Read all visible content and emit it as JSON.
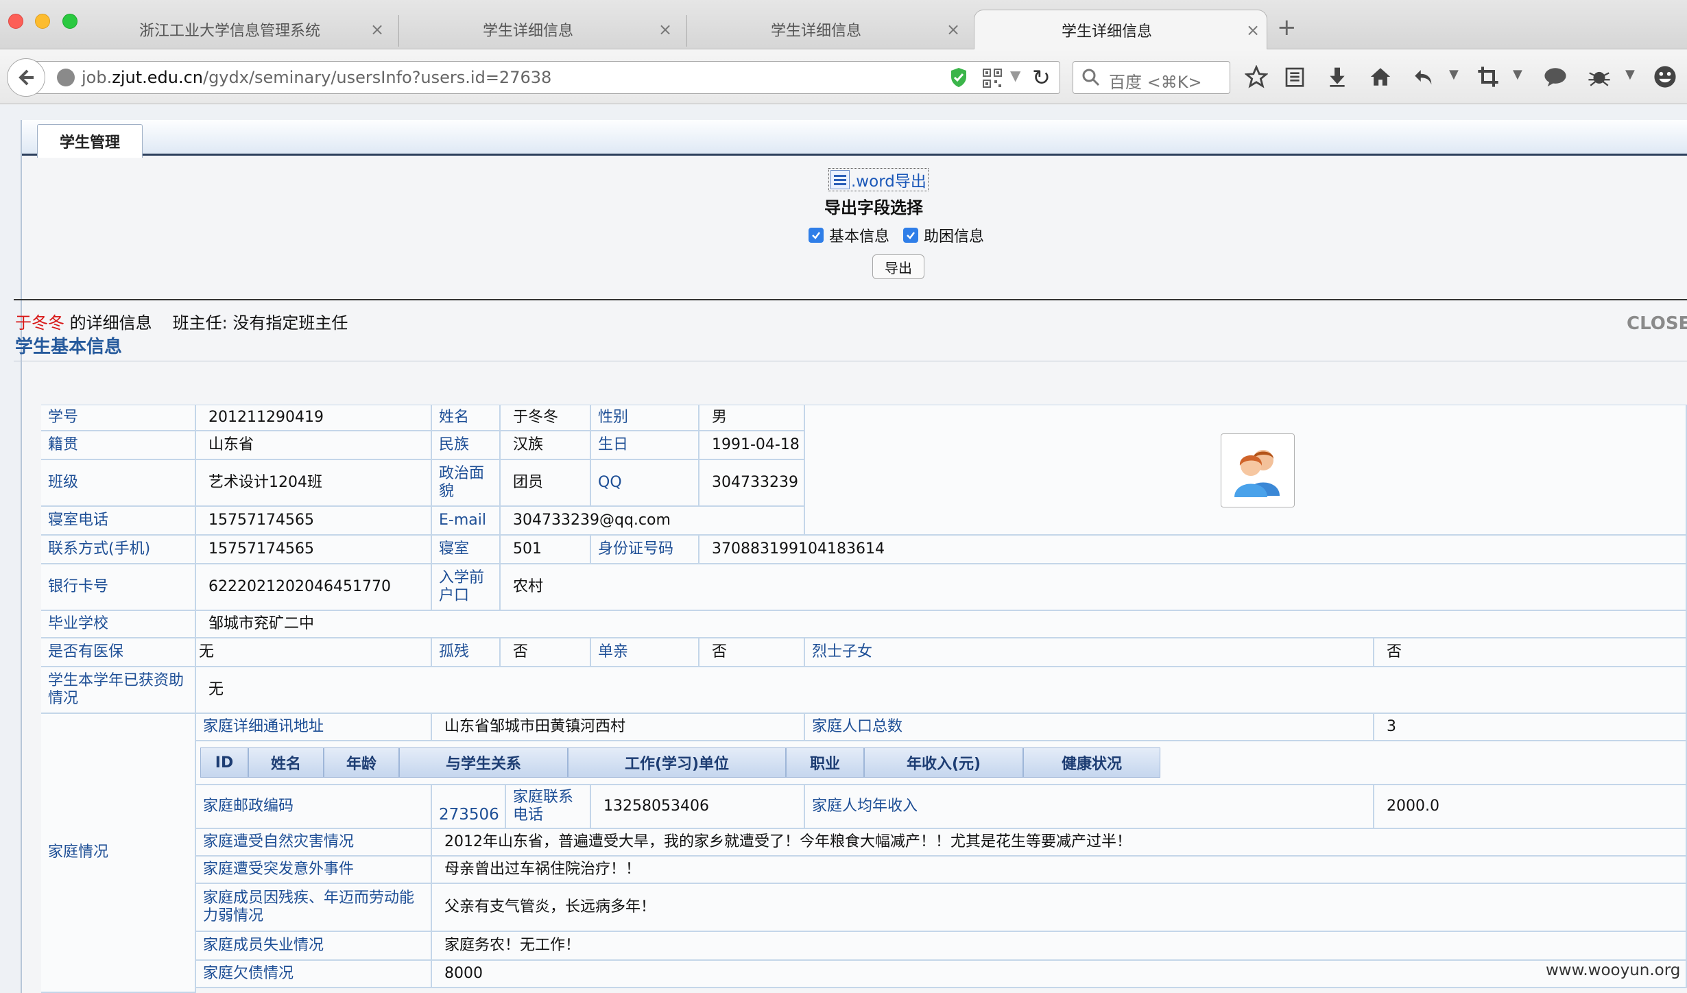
{
  "browser": {
    "tabs": [
      {
        "label": "浙江工业大学信息管理系统"
      },
      {
        "label": "学生详细信息"
      },
      {
        "label": "学生详细信息"
      },
      {
        "label": "学生详细信息"
      }
    ],
    "close_glyph": "×",
    "new_tab_glyph": "+",
    "url": {
      "prefix": "job.",
      "domain": "zjut.edu.cn",
      "path": "/gydx/seminary/usersInfo?users.id=27638"
    },
    "search_placeholder": "百度 <⌘K>",
    "toolbar_icons": [
      "bookmark-star-icon",
      "reading-list-icon",
      "download-icon",
      "home-icon",
      "undo-icon",
      "crop-icon",
      "chat-icon",
      "bug-icon",
      "emoji-icon"
    ]
  },
  "page": {
    "module_tab": "学生管理",
    "export": {
      "word_link": ".word导出",
      "title": "导出字段选择",
      "options": [
        {
          "label": "基本信息",
          "checked": true
        },
        {
          "label": "助困信息",
          "checked": true
        }
      ],
      "button": "导出"
    },
    "header": {
      "student_name": "于冬冬",
      "detail_suffix": " 的详细信息",
      "head_teacher": "班主任: 没有指定班主任",
      "close": "CLOSE"
    },
    "section_title": "学生基本信息",
    "basic": {
      "student_id_label": "学号",
      "student_id": "201211290419",
      "name_label": "姓名",
      "name": "于冬冬",
      "gender_label": "性别",
      "gender": "男",
      "origin_label": "籍贯",
      "origin": "山东省",
      "ethnicity_label": "民族",
      "ethnicity": "汉族",
      "birthday_label": "生日",
      "birthday": "1991-04-18",
      "class_label": "班级",
      "class": "艺术设计1204班",
      "political_label": "政治面貌",
      "political": "团员",
      "qq_label": "QQ",
      "qq": "304733239",
      "dorm_phone_label": "寝室电话",
      "dorm_phone": "15757174565",
      "email_label": "E-mail",
      "email": "304733239@qq.com",
      "mobile_label": "联系方式(手机)",
      "mobile": "15757174565",
      "dorm_label": "寝室",
      "dorm": "501",
      "id_card_label": "身份证号码",
      "id_card": "370883199104183614",
      "bank_label": "银行卡号",
      "bank": "6222021202046451770",
      "hukou_label": "入学前户口",
      "hukou": "农村",
      "school_label": "毕业学校",
      "school": "邹城市兖矿二中",
      "insurance_label": "是否有医保",
      "insurance": "无",
      "orphan_label": "孤残",
      "orphan": "否",
      "single_label": "单亲",
      "single": "否",
      "martyr_label": "烈士子女",
      "martyr": "否",
      "aid_label": "学生本学年已获资助情况",
      "aid": "无"
    },
    "family": {
      "section_label": "家庭情况",
      "address_label": "家庭详细通讯地址",
      "address": "山东省邹城市田黄镇河西村",
      "population_label": "家庭人口总数",
      "population": "3",
      "member_columns": [
        "ID",
        "姓名",
        "年龄",
        "与学生关系",
        "工作(学习)单位",
        "职业",
        "年收入(元)",
        "健康状况"
      ],
      "postcode_label": "家庭邮政编码",
      "postcode": "273506",
      "phone_label": "家庭联系电话",
      "phone": "13258053406",
      "avg_income_label": "家庭人均年收入",
      "avg_income": "2000.0",
      "disaster_label": "家庭遭受自然灾害情况",
      "disaster": "2012年山东省，普遍遭受大旱，我的家乡就遭受了！今年粮食大幅减产！！尤其是花生等要减产过半！",
      "accident_label": "家庭遭受突发意外事件",
      "accident": "母亲曾出过车祸住院治疗！！",
      "disability_label": "家庭成员因残疾、年迈而劳动能力弱情况",
      "disability": "父亲有支气管炎，长远病多年！",
      "unemployment_label": "家庭成员失业情况",
      "unemployment": "家庭务农！无工作！",
      "debt_label": "家庭欠债情况",
      "debt": "8000"
    }
  },
  "watermark": "www.wooyun.org"
}
